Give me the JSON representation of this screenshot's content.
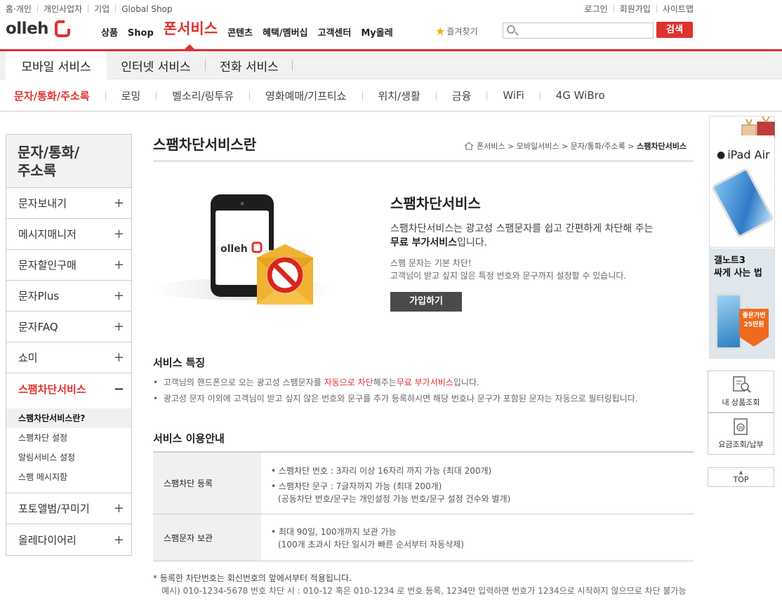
{
  "util_left": [
    "홈·개인",
    "개인사업자",
    "기업",
    "Global Shop"
  ],
  "util_right": [
    "로그인",
    "회원가입",
    "사이트맵"
  ],
  "logo": "olleh",
  "gnb": [
    "상품",
    "Shop",
    "폰서비스",
    "콘텐츠",
    "혜택/멤버십",
    "고객센터",
    "My올레"
  ],
  "favorites": "즐겨찾기",
  "search": {
    "placeholder": "",
    "button": "검색"
  },
  "tabs1": [
    "모바일 서비스",
    "인터넷 서비스",
    "전화 서비스"
  ],
  "tabs2": [
    "문자/통화/주소록",
    "로밍",
    "벨소리/링투유",
    "영화예매/기프티쇼",
    "위치/생활",
    "금융",
    "WiFi",
    "4G WiBro"
  ],
  "lnb": {
    "title_line1": "문자/통화/",
    "title_line2": "주소록",
    "items_top": [
      "문자보내기",
      "메시지매니저",
      "문자할인구매",
      "문자Plus",
      "문자FAQ",
      "쇼미"
    ],
    "active": "스팸차단서비스",
    "sub": [
      "스팸차단서비스란?",
      "스팸차단 설정",
      "알림서비스 설정",
      "스팸 메시지함"
    ],
    "items_bottom": [
      "포토앨범/꾸미기",
      "올레다이어리"
    ],
    "plus": "+",
    "minus": "−"
  },
  "page_title": "스팸차단서비스란",
  "breadcrumb": [
    "폰서비스",
    "모바일서비스",
    "문자/통화/주소록",
    "스팸차단서비스"
  ],
  "promo": {
    "title": "스팸차단서비스",
    "desc1": "스팸차단서비스는 광고성 스팸문자를 쉽고 간편하게 차단해 주는",
    "desc2_bold": "무료 부가서비스",
    "desc2_rest": "입니다.",
    "note1": "스팸 문자는 기본 차단!",
    "note2": "고객님이 받고 싶지 않은 특정 번호와 문구까지 설정할 수 있습니다.",
    "join": "가입하기",
    "phone_logo": "olleh"
  },
  "features": {
    "title": "서비스 특징",
    "b1_pre": "고객님의 핸드폰으로 오는 광고성 스팸문자를 ",
    "b1_red1": "자동으로 차단",
    "b1_mid": "해주는",
    "b1_red2": "무료 부가서비스",
    "b1_post": "입니다.",
    "b2": "광고성 문자 이외에 고객님이 받고 싶지 않은 번호와 문구를 추가 등록하시면 해당 번호나 문구가 포함된 문자는 자동으로 필터링됩니다."
  },
  "guide": {
    "title": "서비스 이용안내",
    "rows": [
      {
        "th": "스팸차단 등록",
        "l1": "스팸차단 번호 : 3자리 이상 16자리 까지 가능 (최대 200개)",
        "l2": "스팸차단 문구 : 7글자까지 가능 (최대 200개)",
        "l3": "(공동차단 번호/문구는 개인설정 가능 번호/문구 설정 건수와 별개)"
      },
      {
        "th": "스팸문자 보관",
        "l1": "최대 90일, 100개까지 보관 가능",
        "l2": "(100개 초과시 차단 일시가 빠른 순서부터 자동삭제)"
      }
    ]
  },
  "footnote": {
    "line1": "* 등록한 차단번호는 회신번호의 앞에서부터 적용됩니다.",
    "line2": "예시) 010-1234-5678 번호 차단 시 : 010-12 혹은 010-1234 로 번호 등록, 1234만 입력하면 번호가 1234으로 시작하지 않으므로 차단 불가능"
  },
  "ad": {
    "ipad": "iPad Air",
    "galaxy1": "갤노트3",
    "galaxy2": "싸게 사는 법",
    "badge1": "좋은가번",
    "badge2": "25만원"
  },
  "quick": [
    {
      "label": "내 상품조회"
    },
    {
      "label": "요금조회/납부"
    }
  ],
  "top": "TOP",
  "colors": {
    "accent": "#e0312f"
  }
}
